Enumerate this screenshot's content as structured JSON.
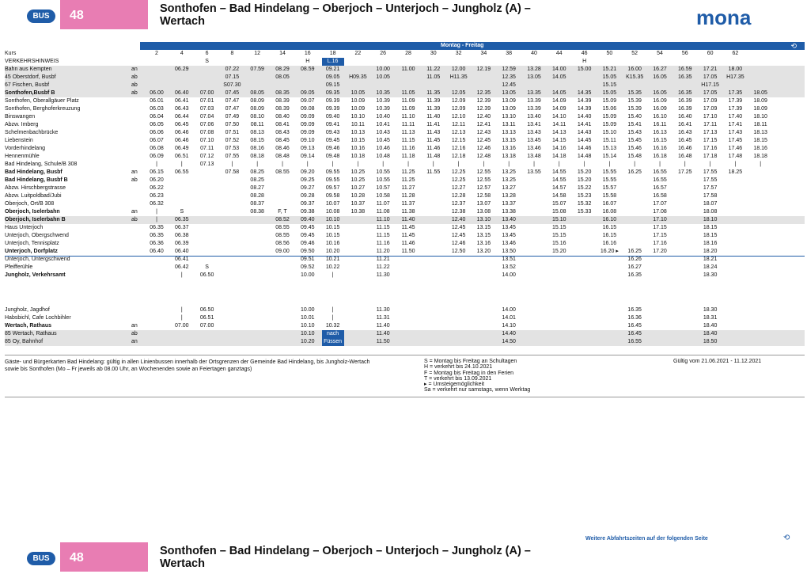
{
  "header": {
    "bus_label": "BUS",
    "line_number": "48",
    "route_title_1": "Sonthofen – Bad Hindelang – Oberjoch – Unterjoch – Jungholz (A) –",
    "route_title_2": "Wertach",
    "brand": "mona"
  },
  "table": {
    "day_label": "Montag - Freitag",
    "kurs_label": "Kurs",
    "hinweis_label": "VERKEHRSHINWEIS",
    "kurs": [
      "2",
      "4",
      "6",
      "8",
      "12",
      "14",
      "16",
      "18",
      "22",
      "26",
      "28",
      "30",
      "32",
      "34",
      "38",
      "40",
      "44",
      "46",
      "50",
      "52",
      "54",
      "56",
      "60",
      "62"
    ],
    "hinweis": [
      "",
      "",
      "S",
      "",
      "",
      "",
      "H",
      "L.16",
      "",
      "",
      "",
      "",
      "",
      "",
      "",
      "",
      "",
      "H",
      "",
      "",
      "",
      "",
      "",
      ""
    ],
    "rows": [
      {
        "stop": "Bahn aus Kempten",
        "aa": "an",
        "shade": true,
        "cells": [
          "",
          "06.29",
          "",
          "07.22",
          "07.59",
          "08.29",
          "08.59",
          "09.21",
          "",
          "10.00",
          "11.00",
          "11.22",
          "12.00",
          "12.19",
          "12.59",
          "13.28",
          "14.00",
          "15.00",
          "15.21",
          "16.00",
          "16.27",
          "16.59",
          "17.21",
          "18.00"
        ]
      },
      {
        "stop": "45 Oberstdorf, Busbf",
        "aa": "ab",
        "shade": true,
        "cells": [
          "",
          "",
          "",
          "07.15",
          "",
          "08.05",
          "",
          "09.05",
          "H09.35",
          "10.05",
          "",
          "11.05",
          "H11.35",
          "",
          "12.35",
          "13.05",
          "14.05",
          "",
          "15.05",
          "K15.35",
          "16.05",
          "16.35",
          "17.05",
          "H17.35"
        ]
      },
      {
        "stop": "67 Fischen, Busbf",
        "aa": "ab",
        "shade": true,
        "cells": [
          "",
          "",
          "",
          "S07.30",
          "",
          "",
          "",
          "09.15",
          "",
          "",
          "",
          "",
          "",
          "",
          "12.45",
          "",
          "",
          "",
          "15.15",
          "",
          "",
          "",
          "H17.15",
          ""
        ]
      },
      {
        "stop": "Sonthofen,Busbf B",
        "aa": "ab",
        "bold": true,
        "shade": true,
        "cells": [
          "06.00",
          "06.40",
          "07.00",
          "07.45",
          "08.05",
          "08.35",
          "09.05",
          "09.35",
          "10.05",
          "10.35",
          "11.05",
          "11.35",
          "12.05",
          "12.35",
          "13.05",
          "13.35",
          "14.05",
          "14.35",
          "15.05",
          "15.35",
          "16.05",
          "16.35",
          "17.05",
          "17.35",
          "18.05"
        ]
      },
      {
        "stop": "Sonthofen, Oberallgäuer Platz",
        "aa": "",
        "cells": [
          "06.01",
          "06.41",
          "07.01",
          "07.47",
          "08.09",
          "08.39",
          "09.07",
          "09.39",
          "10.09",
          "10.39",
          "11.09",
          "11.39",
          "12.09",
          "12.39",
          "13.09",
          "13.39",
          "14.09",
          "14.39",
          "15.09",
          "15.39",
          "16.09",
          "16.39",
          "17.09",
          "17.39",
          "18.09"
        ]
      },
      {
        "stop": "Sonthofen, Berghoferkreuzung",
        "aa": "",
        "cells": [
          "06.03",
          "06.43",
          "07.03",
          "07.47",
          "08.09",
          "08.39",
          "09.08",
          "09.39",
          "10.09",
          "10.39",
          "11.09",
          "11.39",
          "12.09",
          "12.39",
          "13.09",
          "13.39",
          "14.09",
          "14.39",
          "15.06",
          "15.39",
          "16.09",
          "16.39",
          "17.09",
          "17.39",
          "18.09"
        ]
      },
      {
        "stop": "Binswangen",
        "aa": "",
        "cells": [
          "06.04",
          "06.44",
          "07.04",
          "07.49",
          "08.10",
          "08.40",
          "09.09",
          "09.40",
          "10.10",
          "10.40",
          "11.10",
          "11.40",
          "12.10",
          "12.40",
          "13.10",
          "13.40",
          "14.10",
          "14.40",
          "15.09",
          "15.40",
          "16.10",
          "16.40",
          "17.10",
          "17.40",
          "18.10"
        ]
      },
      {
        "stop": "Abzw. Imberg",
        "aa": "",
        "cells": [
          "06.05",
          "06.45",
          "07.06",
          "07.50",
          "08.11",
          "08.41",
          "09.09",
          "09.41",
          "10.11",
          "10.41",
          "11.11",
          "11.41",
          "12.11",
          "12.41",
          "13.11",
          "13.41",
          "14.11",
          "14.41",
          "15.09",
          "15.41",
          "16.11",
          "16.41",
          "17.11",
          "17.41",
          "18.11"
        ]
      },
      {
        "stop": "Schelmenbachbrücke",
        "aa": "",
        "cells": [
          "06.06",
          "06.46",
          "07.08",
          "07.51",
          "08.13",
          "08.43",
          "09.09",
          "09.43",
          "10.13",
          "10.43",
          "11.13",
          "11.43",
          "12.13",
          "12.43",
          "13.13",
          "13.43",
          "14.13",
          "14.43",
          "15.10",
          "15.43",
          "16.13",
          "16.43",
          "17.13",
          "17.43",
          "18.13"
        ]
      },
      {
        "stop": "Liebenstein",
        "aa": "",
        "cells": [
          "06.07",
          "06.46",
          "07.10",
          "07.52",
          "08.15",
          "08.45",
          "09.10",
          "09.45",
          "10.15",
          "10.45",
          "11.15",
          "11.45",
          "12.15",
          "12.45",
          "13.15",
          "13.45",
          "14.15",
          "14.45",
          "15.11",
          "15.45",
          "16.15",
          "16.45",
          "17.15",
          "17.45",
          "18.15"
        ]
      },
      {
        "stop": "Vorderhindelang",
        "aa": "",
        "cells": [
          "06.08",
          "06.49",
          "07.11",
          "07.53",
          "08.16",
          "08.46",
          "09.13",
          "09.46",
          "10.16",
          "10.46",
          "11.16",
          "11.46",
          "12.16",
          "12.46",
          "13.16",
          "13.46",
          "14.16",
          "14.46",
          "15.13",
          "15.46",
          "16.16",
          "16.46",
          "17.16",
          "17.46",
          "18.16"
        ]
      },
      {
        "stop": "Hennenmühle",
        "aa": "",
        "cells": [
          "06.09",
          "06.51",
          "07.12",
          "07.55",
          "08.18",
          "08.48",
          "09.14",
          "09.48",
          "10.18",
          "10.48",
          "11.18",
          "11.48",
          "12.18",
          "12.48",
          "13.18",
          "13.48",
          "14.18",
          "14.48",
          "15.14",
          "15.48",
          "16.18",
          "16.48",
          "17.18",
          "17.48",
          "18.18"
        ]
      },
      {
        "stop": "Bad Hindelang, Schule/B 308",
        "aa": "",
        "cells": [
          "|",
          "|",
          "07.13",
          "|",
          "|",
          "|",
          "|",
          "|",
          "|",
          "|",
          "|",
          "|",
          "|",
          "|",
          "|",
          "|",
          "|",
          "|",
          "|",
          "|",
          "|",
          "|",
          "|",
          "|",
          "|"
        ]
      },
      {
        "stop": "Bad Hindelang, Busbf",
        "aa": "an",
        "bold": true,
        "cells": [
          "06.15",
          "06.55",
          "",
          "07.58",
          "08.25",
          "08.55",
          "09.20",
          "09.55",
          "10.25",
          "10.55",
          "11.25",
          "11.55",
          "12.25",
          "12.55",
          "13.25",
          "13.55",
          "14.55",
          "15.20",
          "15.55",
          "16.25",
          "16.55",
          "17.25",
          "17.55",
          "18.25"
        ]
      },
      {
        "stop": "Bad Hindelang, Busbf B",
        "aa": "ab",
        "bold": true,
        "cells": [
          "06.20",
          "",
          "",
          "",
          "08.25",
          "",
          "09.25",
          "09.55",
          "10.25",
          "10.55",
          "11.25",
          "",
          "12.25",
          "12.55",
          "13.25",
          "",
          "14.55",
          "15.20",
          "15.55",
          "",
          "16.55",
          "",
          "17.55"
        ]
      },
      {
        "stop": "Abzw. Hirschbergstrasse",
        "aa": "",
        "cells": [
          "06.22",
          "",
          "",
          "",
          "08.27",
          "",
          "09.27",
          "09.57",
          "10.27",
          "10.57",
          "11.27",
          "",
          "12.27",
          "12.57",
          "13.27",
          "",
          "14.57",
          "15.22",
          "15.57",
          "",
          "16.57",
          "",
          "17.57"
        ]
      },
      {
        "stop": "Abzw. Luitpoldbad/Jubi",
        "aa": "",
        "cells": [
          "06.23",
          "",
          "",
          "",
          "08.28",
          "",
          "09.28",
          "09.58",
          "10.28",
          "10.58",
          "11.28",
          "",
          "12.28",
          "12.58",
          "13.28",
          "",
          "14.58",
          "15.23",
          "15.58",
          "",
          "16.58",
          "",
          "17.58"
        ]
      },
      {
        "stop": "Oberjoch, Ort/B 308",
        "aa": "",
        "cells": [
          "06.32",
          "",
          "",
          "",
          "08.37",
          "",
          "09.37",
          "10.07",
          "10.37",
          "11.07",
          "11.37",
          "",
          "12.37",
          "13.07",
          "13.37",
          "",
          "15.07",
          "15.32",
          "16.07",
          "",
          "17.07",
          "",
          "18.07"
        ]
      },
      {
        "stop": "Oberjoch, Iselerbahn",
        "aa": "an",
        "bold": true,
        "ul": true,
        "cells": [
          "|",
          "S",
          "",
          "",
          "08.38",
          "F, T",
          "09.38",
          "10.08",
          "10.38",
          "11.08",
          "11.38",
          "",
          "12.38",
          "13.08",
          "13.38",
          "",
          "15.08",
          "15.33",
          "16.08",
          "",
          "17.08",
          "",
          "18.08"
        ]
      },
      {
        "stop": "Oberjoch, Iselerbahn B",
        "aa": "ab",
        "bold": true,
        "shade": true,
        "cells": [
          "|",
          "06.35",
          "",
          "",
          "",
          "08.52",
          "09.40",
          "10.10",
          "",
          "11.10",
          "11.40",
          "",
          "12.40",
          "13.10",
          "13.40",
          "",
          "15.10",
          "",
          "16.10",
          "",
          "17.10",
          "",
          "18.10"
        ]
      },
      {
        "stop": "Haus Unterjoch",
        "aa": "",
        "cells": [
          "06.35",
          "06.37",
          "",
          "",
          "",
          "08.55",
          "09.45",
          "10.15",
          "",
          "11.15",
          "11.45",
          "",
          "12.45",
          "13.15",
          "13.45",
          "",
          "15.15",
          "",
          "16.15",
          "",
          "17.15",
          "",
          "18.15"
        ]
      },
      {
        "stop": "Unterjoch, Obergschwend",
        "aa": "",
        "cells": [
          "06.35",
          "06.38",
          "",
          "",
          "",
          "08.55",
          "09.45",
          "10.15",
          "",
          "11.15",
          "11.45",
          "",
          "12.45",
          "13.15",
          "13.45",
          "",
          "15.15",
          "",
          "16.15",
          "",
          "17.15",
          "",
          "18.15"
        ]
      },
      {
        "stop": "Unterjoch, Tennisplatz",
        "aa": "",
        "cells": [
          "06.36",
          "06.39",
          "",
          "",
          "",
          "08.56",
          "09.46",
          "10.16",
          "",
          "11.16",
          "11.46",
          "",
          "12.46",
          "13.16",
          "13.46",
          "",
          "15.16",
          "",
          "16.16",
          "",
          "17.16",
          "",
          "18.16"
        ]
      },
      {
        "stop": "Unterjoch, Dorfplatz",
        "aa": "",
        "bold": true,
        "ul": true,
        "cells": [
          "06.40",
          "06.40",
          "",
          "",
          "",
          "09.00",
          "09.50",
          "10.20",
          "",
          "11.20",
          "11.50",
          "",
          "12.50",
          "13.20",
          "13.50",
          "",
          "15.20",
          "",
          "16.20 ▸",
          "16.25",
          "17.20",
          "",
          "18.20"
        ]
      },
      {
        "stop": "Unterjoch, Untergschwend",
        "aa": "",
        "cells": [
          "",
          "06.41",
          "",
          "",
          "",
          "",
          "09.51",
          "10.21",
          "",
          "11.21",
          "",
          "",
          "",
          "",
          "13.51",
          "",
          "",
          "",
          "",
          "16.26",
          "",
          "",
          "18.21"
        ]
      },
      {
        "stop": "Pfeifferühle",
        "aa": "",
        "cells": [
          "",
          "06.42",
          "S",
          "",
          "",
          "",
          "09.52",
          "10.22",
          "",
          "11.22",
          "",
          "",
          "",
          "",
          "13.52",
          "",
          "",
          "",
          "",
          "16.27",
          "",
          "",
          "18.24"
        ]
      },
      {
        "stop": "Jungholz, Verkehrsamt",
        "aa": "",
        "bold": true,
        "cells": [
          "",
          "|",
          "06.50",
          "",
          "",
          "",
          "10.00",
          "|",
          "",
          "11.30",
          "",
          "",
          "",
          "",
          "14.00",
          "",
          "",
          "",
          "",
          "16.35",
          "",
          "",
          "18.30"
        ]
      }
    ],
    "rows2": [
      {
        "stop": "Jungholz, Jagdhof",
        "aa": "",
        "cells": [
          "",
          "|",
          "06.50",
          "",
          "",
          "",
          "10.00",
          "|",
          "",
          "11.30",
          "",
          "",
          "",
          "",
          "14.00",
          "",
          "",
          "",
          "",
          "16.35",
          "",
          "",
          "18.30"
        ]
      },
      {
        "stop": "Habsbichl, Cafe Lochbihler",
        "aa": "",
        "cells": [
          "",
          "|",
          "06.51",
          "",
          "",
          "",
          "10.01",
          "|",
          "",
          "11.31",
          "",
          "",
          "",
          "",
          "14.01",
          "",
          "",
          "",
          "",
          "16.36",
          "",
          "",
          "18.31"
        ]
      },
      {
        "stop": "Wertach, Rathaus",
        "aa": "an",
        "bold": true,
        "cells": [
          "",
          "07.00",
          "07.00",
          "",
          "",
          "",
          "10.10",
          "10.32",
          "",
          "11.40",
          "",
          "",
          "",
          "",
          "14.10",
          "",
          "",
          "",
          "",
          "16.45",
          "",
          "",
          "18.40"
        ]
      },
      {
        "stop": "85 Wertach, Rathaus",
        "aa": "ab",
        "shade": true,
        "cells": [
          "",
          "",
          "",
          "",
          "",
          "",
          "10.10",
          "nach",
          "",
          "11.40",
          "",
          "",
          "",
          "",
          "14.40",
          "",
          "",
          "",
          "",
          "16.45",
          "",
          "",
          "18.40"
        ]
      },
      {
        "stop": "85 Oy, Bahnhof",
        "aa": "an",
        "shade": true,
        "cells": [
          "",
          "",
          "",
          "",
          "",
          "",
          "10.20",
          "Füssen",
          "",
          "11.50",
          "",
          "",
          "",
          "",
          "14.50",
          "",
          "",
          "",
          "",
          "16.55",
          "",
          "",
          "18.50"
        ]
      }
    ]
  },
  "notes": {
    "left": "Gäste- und Bürgerkarten Bad Hindelang: gültig in allen Linienbussen innerhalb der Ortsgrenzen der Gemeinde Bad Hindelang, bis Jungholz-Wertach sowie bis Sonthofen (Mo – Fr jeweils ab 08.00 Uhr, an Wochenenden sowie an Feiertagen ganztags)",
    "legend": [
      "S = Montag bis Freitag an Schultagen",
      "H = verkehrt bis 24.10.2021",
      "F = Montag bis Freitag in den Ferien",
      "T = verkehrt bis 13.09.2021",
      "▸ = Umsteigemöglichkeit",
      "Sa = verkehrt nur samstags, wenn Werktag"
    ],
    "validity": "Gültig vom 21.06.2021 - 11.12.2021"
  },
  "footer": {
    "more_times": "Weitere Abfahrtszeiten auf der folgenden Seite"
  },
  "colors": {
    "accent_blue": "#1f5ca8",
    "pink": "#e87db3"
  }
}
